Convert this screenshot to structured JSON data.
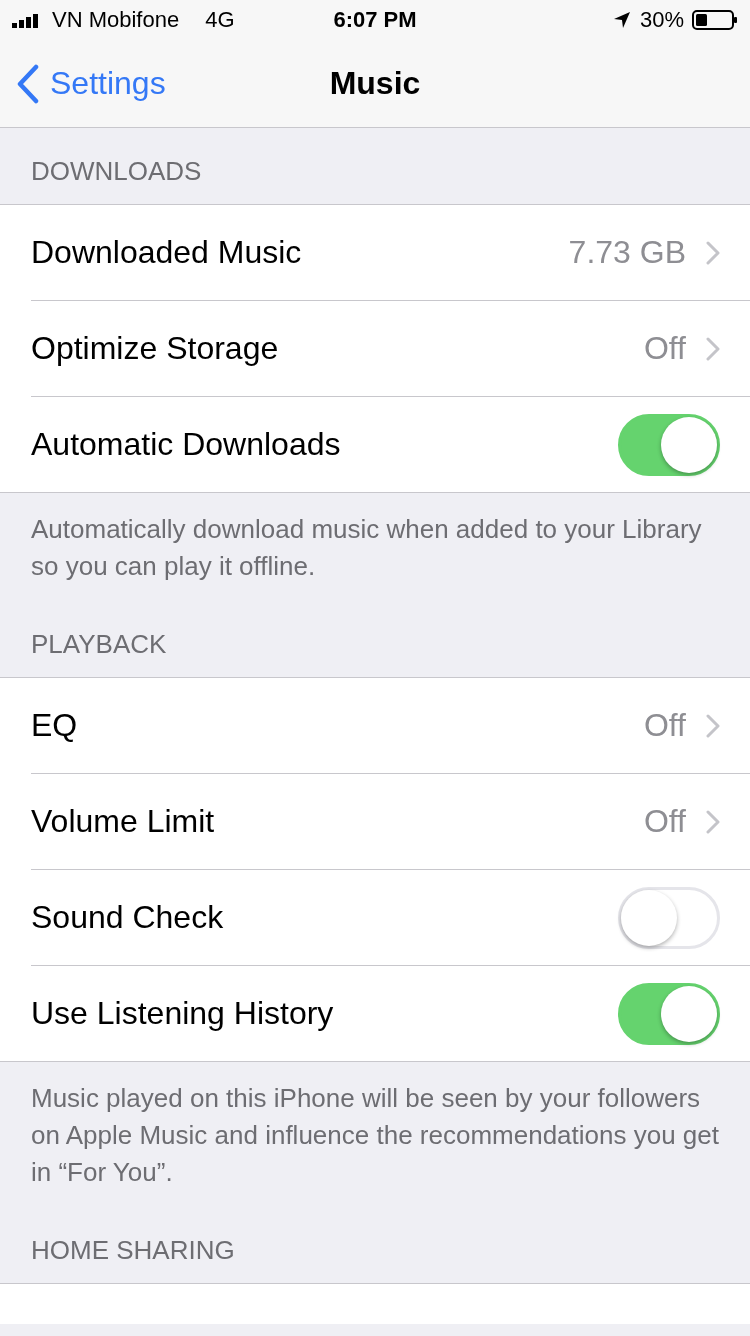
{
  "status_bar": {
    "carrier": "VN Mobifone",
    "network": "4G",
    "time": "6:07 PM",
    "battery": "30%"
  },
  "nav": {
    "back": "Settings",
    "title": "Music"
  },
  "sections": [
    {
      "header": "DOWNLOADS",
      "rows": [
        {
          "kind": "value",
          "label": "Downloaded Music",
          "value": "7.73 GB"
        },
        {
          "kind": "value",
          "label": "Optimize Storage",
          "value": "Off"
        },
        {
          "kind": "toggle",
          "label": "Automatic Downloads",
          "on": true
        }
      ],
      "footer": "Automatically download music when added to your Library so you can play it offline."
    },
    {
      "header": "PLAYBACK",
      "rows": [
        {
          "kind": "value",
          "label": "EQ",
          "value": "Off"
        },
        {
          "kind": "value",
          "label": "Volume Limit",
          "value": "Off"
        },
        {
          "kind": "toggle",
          "label": "Sound Check",
          "on": false
        },
        {
          "kind": "toggle",
          "label": "Use Listening History",
          "on": true
        }
      ],
      "footer": "Music played on this iPhone will be seen by your followers on Apple Music and influence the recommendations you get in “For You”."
    },
    {
      "header": "HOME SHARING"
    }
  ]
}
